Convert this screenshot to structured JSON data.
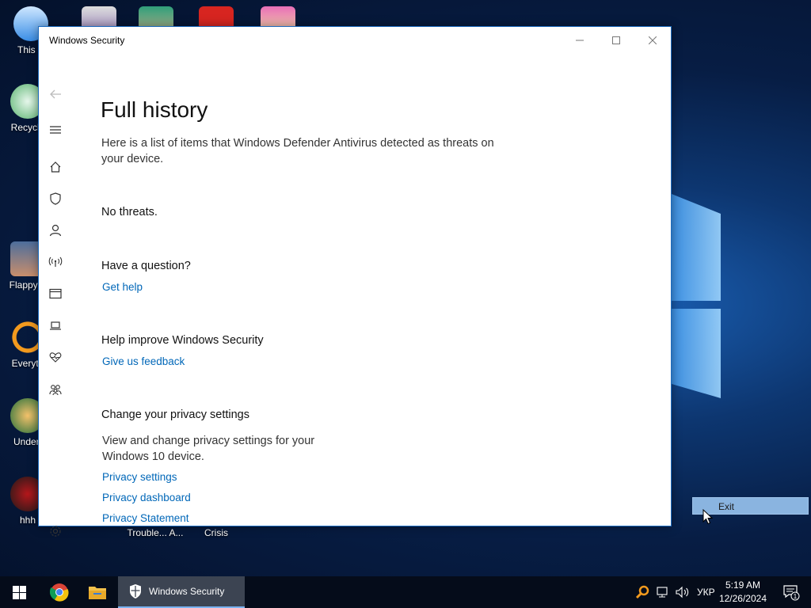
{
  "desktop": {
    "icons": [
      {
        "label": "This P"
      },
      {
        "label": "Recycle"
      },
      {
        "label": "Flappy F"
      },
      {
        "label": "Everyth"
      },
      {
        "label": "Undert"
      },
      {
        "label": "hhh"
      },
      {
        "label": "Trouble... A..."
      },
      {
        "label": "Crisis"
      }
    ]
  },
  "window": {
    "title": "Windows Security",
    "controls": {
      "minimize": "—",
      "maximize": "☐",
      "close": "✕"
    }
  },
  "page": {
    "title": "Full history",
    "description": "Here is a list of items that Windows Defender Antivirus detected as threats on your device.",
    "no_threats": "No threats.",
    "question_heading": "Have a question?",
    "get_help": "Get help",
    "improve_heading": "Help improve Windows Security",
    "feedback_link": "Give us feedback",
    "privacy_heading": "Change your privacy settings",
    "privacy_desc": "View and change privacy settings for your Windows 10 device.",
    "privacy_settings": "Privacy settings",
    "privacy_dashboard": "Privacy dashboard",
    "privacy_statement": "Privacy Statement"
  },
  "context_menu": {
    "exit": "Exit"
  },
  "taskbar": {
    "active_app": "Windows Security",
    "language": "УКР",
    "time": "5:19 AM",
    "date": "12/26/2024",
    "notification_count": "1"
  },
  "colors": {
    "link": "#0067b8",
    "accent": "#1c6bbf"
  }
}
